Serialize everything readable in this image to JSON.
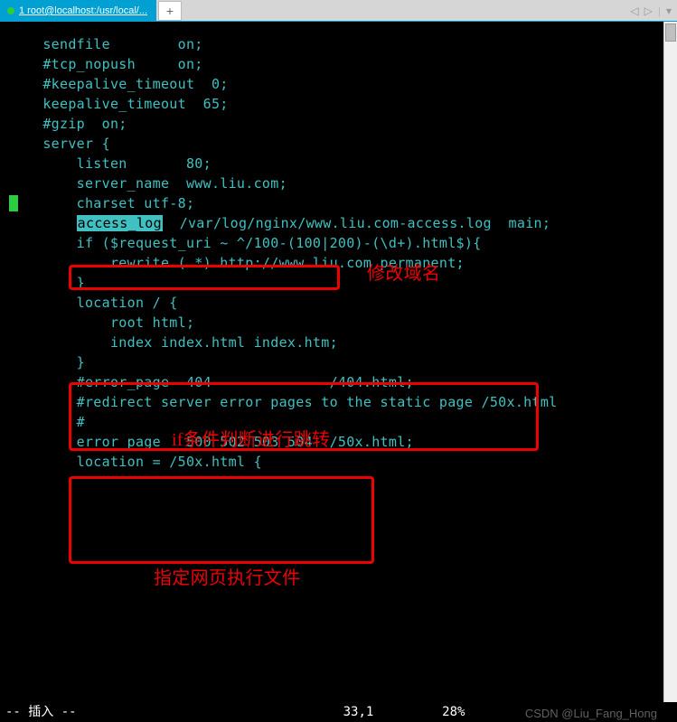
{
  "tab": {
    "indicator": "●",
    "title": "1 root@localhost:/usr/local/..."
  },
  "tab_add_label": "+",
  "nav": {
    "left": "◁",
    "right": "▷",
    "menu": "▾"
  },
  "code": {
    "l01": "    sendfile        on;",
    "l02": "    #tcp_nopush     on;",
    "l03": "",
    "l04": "    #keepalive_timeout  0;",
    "l05": "    keepalive_timeout  65;",
    "l06": "",
    "l07": "    #gzip  on;",
    "l08": "",
    "l09": "    server {",
    "l10": "        listen       80;",
    "l11": "        server_name  www.liu.com;",
    "l12": "",
    "l13": "        charset utf-8;",
    "l14": "",
    "l15a": "        ",
    "l15b": "access_log",
    "l15c": "  /var/log/nginx/www.liu.com-access.log  main;",
    "l16": "",
    "l17": "        if ($request_uri ~ ^/100-(100|200)-(\\d+).html$){",
    "l18": "            rewrite (.*) http://www.liu.com permanent;",
    "l19": "        }",
    "l20": "",
    "l21": "",
    "l22": "        location / {",
    "l23": "            root html;",
    "l24": "            index index.html index.htm;",
    "l25": "        }",
    "l26": "",
    "l27": "",
    "l28": "        #error_page  404              /404.html;",
    "l29": "",
    "l30": "        #redirect server error pages to the static page /50x.html",
    "l31": "        #",
    "l32": "        error_page   500 502 503 504  /50x.html;",
    "l33": "        location = /50x.html {"
  },
  "annotations": {
    "a1": "修改域名",
    "a2": "if条件判断进行跳转",
    "a3": "指定网页执行文件"
  },
  "status": {
    "mode": "-- 插入 --",
    "pos": "33,1",
    "pct": "28%"
  },
  "watermark": "CSDN @Liu_Fang_Hong"
}
